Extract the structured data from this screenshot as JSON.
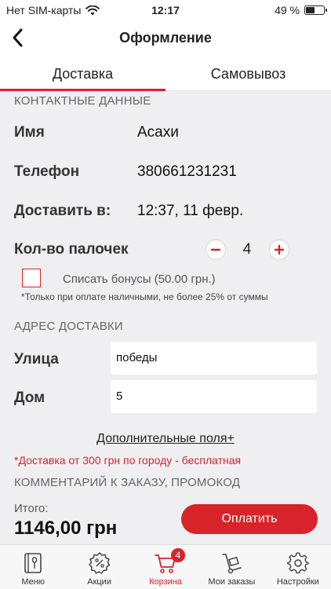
{
  "status_bar": {
    "carrier": "Нет SIM-карты",
    "time": "12:17",
    "battery": "49 %",
    "battery_level": 0.49
  },
  "nav": {
    "title": "Оформление"
  },
  "tabs": [
    {
      "label": "Доставка",
      "active": true
    },
    {
      "label": "Самовывоз",
      "active": false
    }
  ],
  "contacts": {
    "section_title": "КОНТАКТНЫЕ ДАННЫЕ",
    "name_label": "Имя",
    "name_value": "Асахи",
    "phone_label": "Телефон",
    "phone_value": "380661231231",
    "deliver_label": "Доставить в:",
    "deliver_value": "12:37, 11 февр.",
    "sticks_label": "Кол-во палочек",
    "sticks_value": "4"
  },
  "bonus": {
    "label": "Списать бонусы (50.00 грн.)",
    "note": "*Только при оплате наличными, не более 25% от суммы",
    "checked": false
  },
  "address": {
    "section_title": "АДРЕС ДОСТАВКИ",
    "street_label": "Улица",
    "street_value": "победы",
    "house_label": "Дом",
    "house_value": "5"
  },
  "extra_fields_link": "Дополнительные поля+",
  "delivery_note": "*Доставка от 300 грн  по городу - бесплатная",
  "comment_section_title": "КОММЕНТАРИЙ К ЗАКАЗУ, ПРОМОКОД",
  "summary": {
    "total_label": "Итого:",
    "total_value": "1146,00 грн",
    "pay_button": "Оплатить"
  },
  "tabbar": {
    "items": [
      {
        "label": "Меню",
        "icon": "menu-book-icon"
      },
      {
        "label": "Акции",
        "icon": "discount-badge-icon"
      },
      {
        "label": "Корзина",
        "icon": "cart-icon",
        "badge": "4",
        "active": true
      },
      {
        "label": "Мои заказы",
        "icon": "hand-truck-icon"
      },
      {
        "label": "Настройки",
        "icon": "gear-icon"
      }
    ]
  },
  "colors": {
    "accent": "#d8232a",
    "background": "#efeff1",
    "text": "#222222"
  }
}
